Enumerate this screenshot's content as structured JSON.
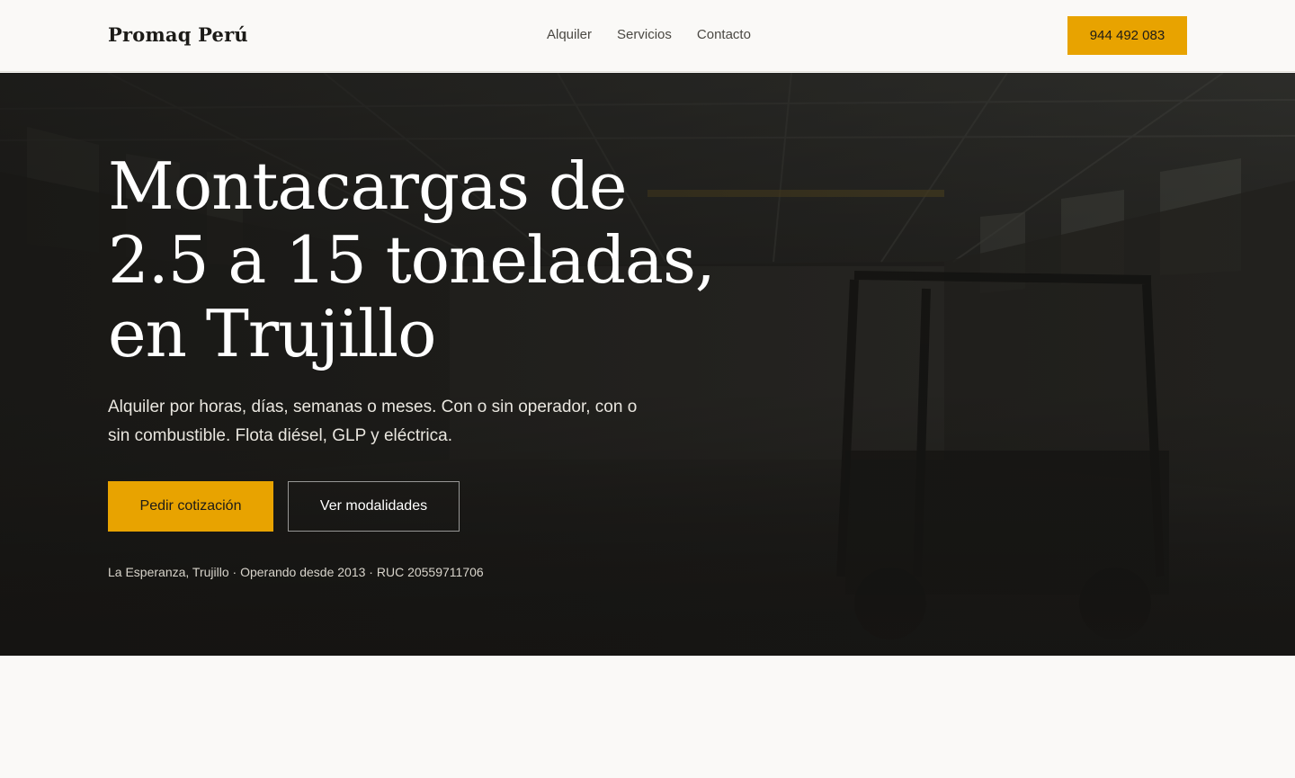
{
  "header": {
    "logo": "Promaq Perú",
    "nav": [
      "Alquiler",
      "Servicios",
      "Contacto"
    ],
    "phone": "944 492 083"
  },
  "hero": {
    "title_lines": [
      "Montacargas de",
      "2.5 a 15 toneladas,",
      "en Trujillo"
    ],
    "subtitle": "Alquiler por horas, días, semanas o meses. Con o sin operador, con o sin combustible. Flota diésel, GLP y eléctrica.",
    "cta_primary": "Pedir cotización",
    "cta_secondary": "Ver modalidades",
    "meta": "La Esperanza, Trujillo · Operando desde 2013 · RUC 20559711706"
  },
  "colors": {
    "accent": "#e8a300",
    "background": "#faf9f7",
    "hero_dark": "#1f1e1b"
  }
}
